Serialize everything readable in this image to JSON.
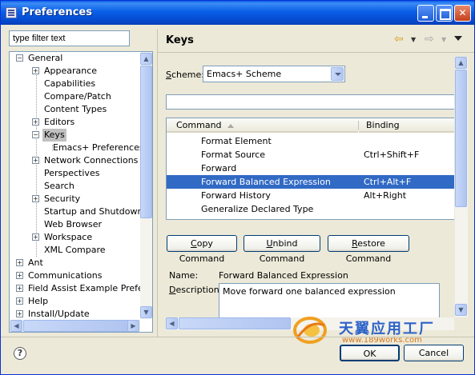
{
  "window": {
    "title": "Preferences"
  },
  "filter": {
    "placeholder": "type filter text"
  },
  "tree": [
    {
      "label": "General",
      "expander": "minus"
    },
    {
      "label": "Appearance",
      "expander": "plus"
    },
    {
      "label": "Capabilities",
      "expander": ""
    },
    {
      "label": "Compare/Patch",
      "expander": ""
    },
    {
      "label": "Content Types",
      "expander": ""
    },
    {
      "label": "Editors",
      "expander": "plus"
    },
    {
      "label": "Keys",
      "expander": "minus",
      "selected": true
    },
    {
      "label": "Emacs+ Preferences",
      "expander": ""
    },
    {
      "label": "Network Connections",
      "expander": "plus"
    },
    {
      "label": "Perspectives",
      "expander": ""
    },
    {
      "label": "Search",
      "expander": ""
    },
    {
      "label": "Security",
      "expander": "plus"
    },
    {
      "label": "Startup and Shutdown",
      "expander": ""
    },
    {
      "label": "Web Browser",
      "expander": ""
    },
    {
      "label": "Workspace",
      "expander": "plus"
    },
    {
      "label": "XML Compare",
      "expander": ""
    },
    {
      "label": "Ant",
      "expander": "plus"
    },
    {
      "label": "Communications",
      "expander": "plus"
    },
    {
      "label": "Field Assist Example Preferer",
      "expander": "plus"
    },
    {
      "label": "Help",
      "expander": "plus"
    },
    {
      "label": "Install/Update",
      "expander": "plus"
    }
  ],
  "page": {
    "title": "Keys"
  },
  "scheme": {
    "label": "Scheme:",
    "value": "Emacs+ Scheme"
  },
  "table": {
    "columns": [
      "Command",
      "Binding"
    ],
    "rows": [
      {
        "command": "Format Element",
        "binding": ""
      },
      {
        "command": "Format Source",
        "binding": "Ctrl+Shift+F"
      },
      {
        "command": "Forward",
        "binding": ""
      },
      {
        "command": "Forward Balanced Expression",
        "binding": "Ctrl+Alt+F",
        "selected": true
      },
      {
        "command": "Forward History",
        "binding": "Alt+Right"
      },
      {
        "command": "Generalize Declared Type",
        "binding": ""
      }
    ]
  },
  "buttons": {
    "copy": "Copy Command",
    "unbind": "Unbind Command",
    "restore": "Restore Command",
    "ok": "OK",
    "cancel": "Cancel"
  },
  "details": {
    "name_label": "Name:",
    "name_value": "Forward Balanced Expression",
    "description_label": "Description:",
    "description_value": "Move forward one balanced expression"
  },
  "watermark": {
    "title": "天翼应用工厂",
    "url": "www.189works.com"
  }
}
